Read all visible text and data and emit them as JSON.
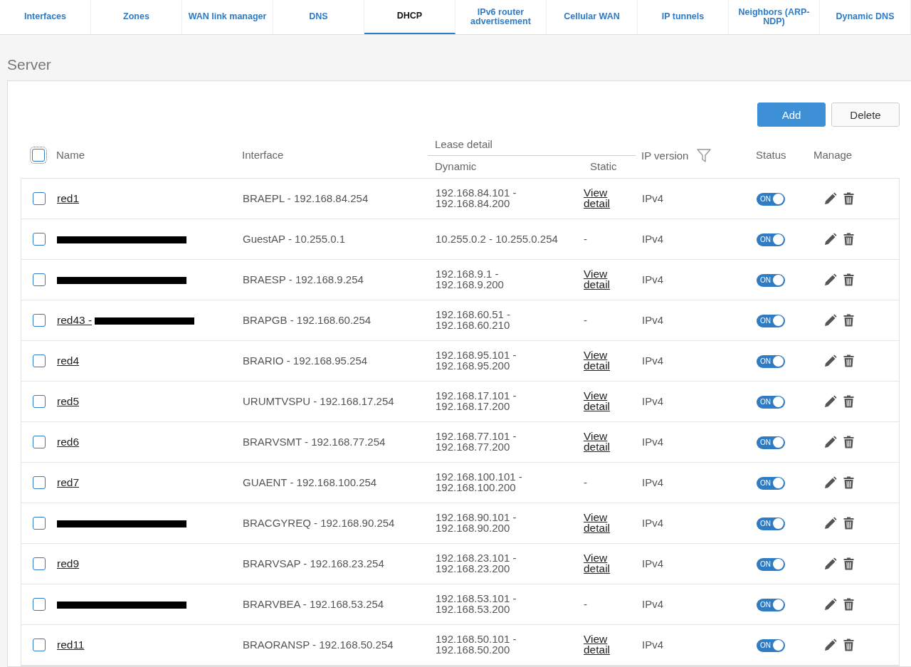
{
  "tabs": [
    {
      "label": "Interfaces",
      "selected": false
    },
    {
      "label": "Zones",
      "selected": false
    },
    {
      "label": "WAN link manager",
      "selected": false
    },
    {
      "label": "DNS",
      "selected": false
    },
    {
      "label": "DHCP",
      "selected": true
    },
    {
      "label": "IPv6 router advertisement",
      "selected": false
    },
    {
      "label": "Cellular WAN",
      "selected": false
    },
    {
      "label": "IP tunnels",
      "selected": false
    },
    {
      "label": "Neighbors (ARP-NDP)",
      "selected": false
    },
    {
      "label": "Dynamic DNS",
      "selected": false
    }
  ],
  "section_title": "Server",
  "buttons": [
    {
      "label": "Add",
      "kind": "primary"
    },
    {
      "label": "Delete",
      "kind": "secondary"
    }
  ],
  "table": {
    "columns": {
      "name": "Name",
      "interface": "Interface",
      "lease_detail": "Lease detail",
      "dynamic": "Dynamic",
      "static": "Static",
      "ip_version": "IP version",
      "status": "Status",
      "manage": "Manage"
    },
    "select_all_checked": false,
    "rows": [
      {
        "checked": false,
        "name": "red1",
        "redacted": false,
        "interface": "BRAEPL - 192.168.84.254",
        "dynamic": [
          "192.168.84.101 -",
          "192.168.84.200"
        ],
        "static": {
          "text": "View detail",
          "kind": "link"
        },
        "ip_version": "IPv4",
        "status": {
          "on": true,
          "label": "ON"
        }
      },
      {
        "checked": false,
        "name": "",
        "redacted": true,
        "interface": "GuestAP - 10.255.0.1",
        "dynamic": [
          "10.255.0.2 - 10.255.0.254"
        ],
        "static": {
          "text": "-",
          "kind": "text"
        },
        "ip_version": "IPv4",
        "status": {
          "on": true,
          "label": "ON"
        }
      },
      {
        "checked": false,
        "name": "",
        "redacted": true,
        "interface": "BRAESP - 192.168.9.254",
        "dynamic": [
          "192.168.9.1 -",
          "192.168.9.200"
        ],
        "static": {
          "text": "View detail",
          "kind": "link"
        },
        "ip_version": "IPv4",
        "status": {
          "on": true,
          "label": "ON"
        }
      },
      {
        "checked": false,
        "name": "red43 -",
        "redacted": true,
        "interface": "BRAPGB - 192.168.60.254",
        "dynamic": [
          "192.168.60.51 -",
          "192.168.60.210"
        ],
        "static": {
          "text": "-",
          "kind": "text"
        },
        "ip_version": "IPv4",
        "status": {
          "on": true,
          "label": "ON"
        }
      },
      {
        "checked": false,
        "name": "red4",
        "redacted": false,
        "interface": "BRARIO - 192.168.95.254",
        "dynamic": [
          "192.168.95.101 -",
          "192.168.95.200"
        ],
        "static": {
          "text": "View detail",
          "kind": "link"
        },
        "ip_version": "IPv4",
        "status": {
          "on": true,
          "label": "ON"
        }
      },
      {
        "checked": false,
        "name": "red5",
        "redacted": false,
        "interface": "URUMTVSPU - 192.168.17.254",
        "dynamic": [
          "192.168.17.101 -",
          "192.168.17.200"
        ],
        "static": {
          "text": "View detail",
          "kind": "link"
        },
        "ip_version": "IPv4",
        "status": {
          "on": true,
          "label": "ON"
        }
      },
      {
        "checked": false,
        "name": "red6",
        "redacted": false,
        "interface": "BRARVSMT - 192.168.77.254",
        "dynamic": [
          "192.168.77.101 -",
          "192.168.77.200"
        ],
        "static": {
          "text": "View detail",
          "kind": "link"
        },
        "ip_version": "IPv4",
        "status": {
          "on": true,
          "label": "ON"
        }
      },
      {
        "checked": false,
        "name": "red7",
        "redacted": false,
        "interface": "GUAENT - 192.168.100.254",
        "dynamic": [
          "192.168.100.101 -",
          "192.168.100.200"
        ],
        "static": {
          "text": "-",
          "kind": "text"
        },
        "ip_version": "IPv4",
        "status": {
          "on": true,
          "label": "ON"
        }
      },
      {
        "checked": false,
        "name": "",
        "redacted": true,
        "interface": "BRACGYREQ - 192.168.90.254",
        "dynamic": [
          "192.168.90.101 -",
          "192.168.90.200"
        ],
        "static": {
          "text": "View detail",
          "kind": "link"
        },
        "ip_version": "IPv4",
        "status": {
          "on": true,
          "label": "ON"
        }
      },
      {
        "checked": false,
        "name": "red9",
        "redacted": false,
        "interface": "BRARVSAP - 192.168.23.254",
        "dynamic": [
          "192.168.23.101 -",
          "192.168.23.200"
        ],
        "static": {
          "text": "View detail",
          "kind": "link"
        },
        "ip_version": "IPv4",
        "status": {
          "on": true,
          "label": "ON"
        }
      },
      {
        "checked": false,
        "name": "",
        "redacted": true,
        "interface": "BRARVBEA - 192.168.53.254",
        "dynamic": [
          "192.168.53.101 -",
          "192.168.53.200"
        ],
        "static": {
          "text": "-",
          "kind": "text"
        },
        "ip_version": "IPv4",
        "status": {
          "on": true,
          "label": "ON"
        }
      },
      {
        "checked": false,
        "name": "red11",
        "redacted": false,
        "interface": "BRAORANSP - 192.168.50.254",
        "dynamic": [
          "192.168.50.101 -",
          "192.168.50.200"
        ],
        "static": {
          "text": "View detail",
          "kind": "link"
        },
        "ip_version": "IPv4",
        "status": {
          "on": true,
          "label": "ON"
        }
      }
    ]
  }
}
